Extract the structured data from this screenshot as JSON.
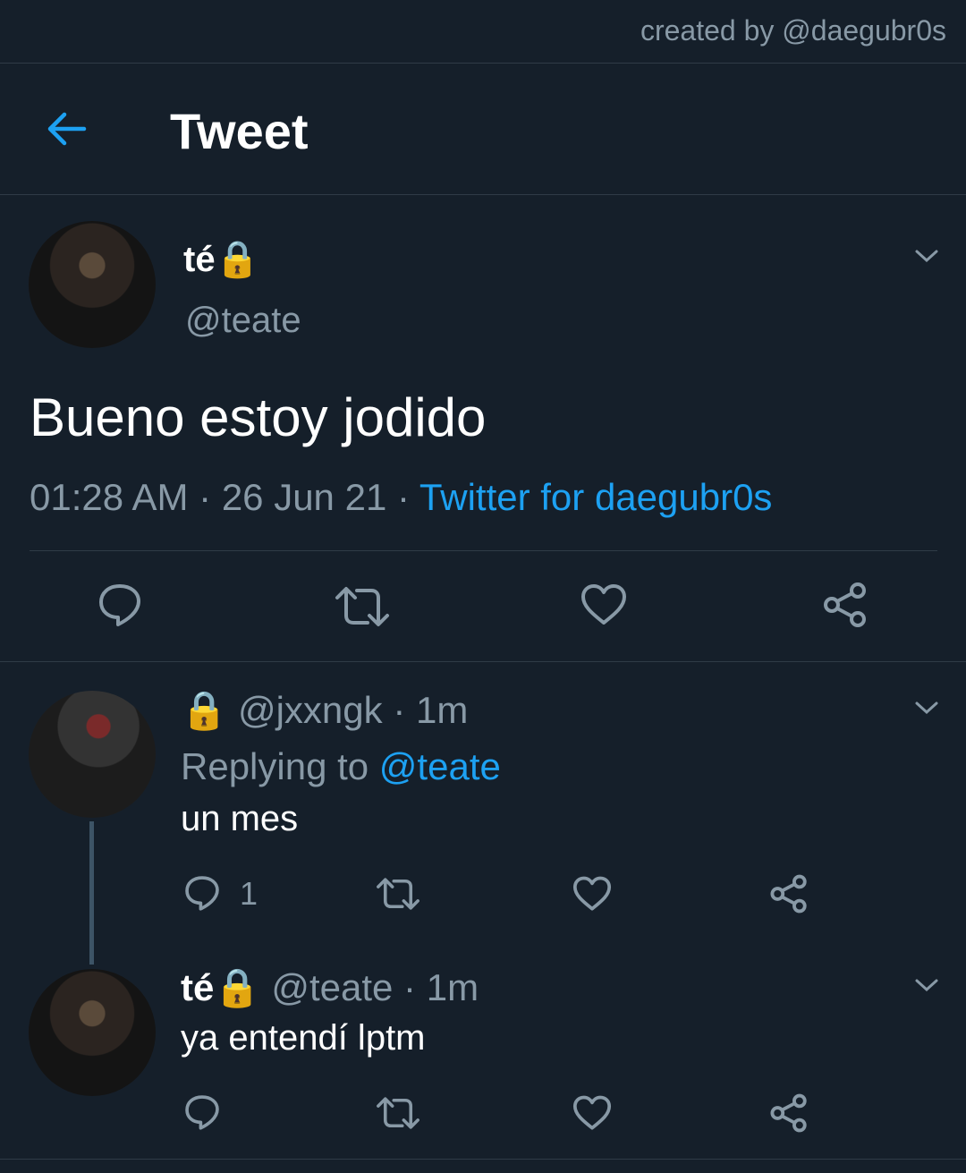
{
  "credit": "created by @daegubr0s",
  "header": {
    "title": "Tweet"
  },
  "main_tweet": {
    "display_name": "té🔒",
    "handle": "@teate",
    "text": "Bueno estoy jodido",
    "time": "01:28 AM",
    "date": "26 Jun 21",
    "source": "Twitter for daegubr0s",
    "sep": "·"
  },
  "replies": [
    {
      "display_name": "🔒",
      "handle": "@jxxngk",
      "age": "1m",
      "replying_label": "Replying to",
      "replying_to": "@teate",
      "text": "un mes",
      "reply_count": "1"
    },
    {
      "display_name": "té🔒",
      "handle": "@teate",
      "age": "1m",
      "text": "ya entendí lptm"
    }
  ],
  "colors": {
    "background": "#151f2a",
    "accent": "#1da1f2",
    "muted": "#8899a6",
    "divider": "#2f3b47"
  }
}
